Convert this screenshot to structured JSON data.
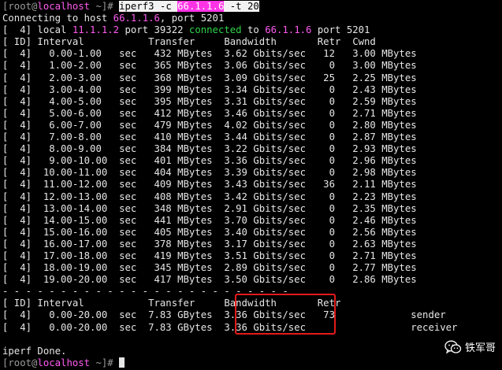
{
  "terminal": {
    "prompt": {
      "user_host": "[root@",
      "host": "localhost",
      "tail": " ~]# "
    },
    "command": {
      "prog": "iperf3 -c ",
      "ip": "66.1.1.6",
      "flags": " -t 20"
    },
    "connecting": {
      "text": "Connecting to host ",
      "host": "66.1.1.6",
      "port_text": ", port 5201"
    },
    "local_line": {
      "prefix": "[  4] local ",
      "local_ip": "11.1.1.2",
      "mid": " port 39322 ",
      "connected": "connected",
      "to": " to ",
      "remote_ip": "66.1.1.6",
      "suffix": " port 5201"
    },
    "header": "[ ID] Interval           Transfer     Bandwidth       Retr  Cwnd",
    "rows": [
      "[  4]   0.00-1.00   sec   432 MBytes  3.62 Gbits/sec   12   3.00 MBytes",
      "[  4]   1.00-2.00   sec   365 MBytes  3.06 Gbits/sec    0   3.00 MBytes",
      "[  4]   2.00-3.00   sec   368 MBytes  3.09 Gbits/sec   25   2.25 MBytes",
      "[  4]   3.00-4.00   sec   399 MBytes  3.34 Gbits/sec    0   2.43 MBytes",
      "[  4]   4.00-5.00   sec   395 MBytes  3.31 Gbits/sec    0   2.59 MBytes",
      "[  4]   5.00-6.00   sec   412 MBytes  3.46 Gbits/sec    0   2.71 MBytes",
      "[  4]   6.00-7.00   sec   479 MBytes  4.02 Gbits/sec    0   2.80 MBytes",
      "[  4]   7.00-8.00   sec   410 MBytes  3.44 Gbits/sec    0   2.87 MBytes",
      "[  4]   8.00-9.00   sec   384 MBytes  3.22 Gbits/sec    0   2.93 MBytes",
      "[  4]   9.00-10.00  sec   401 MBytes  3.36 Gbits/sec    0   2.96 MBytes",
      "[  4]  10.00-11.00  sec   404 MBytes  3.39 Gbits/sec    0   2.98 MBytes",
      "[  4]  11.00-12.00  sec   409 MBytes  3.43 Gbits/sec   36   2.11 MBytes",
      "[  4]  12.00-13.00  sec   408 MBytes  3.42 Gbits/sec    0   2.23 MBytes",
      "[  4]  13.00-14.00  sec   348 MBytes  2.91 Gbits/sec    0   2.35 MBytes",
      "[  4]  14.00-15.00  sec   441 MBytes  3.70 Gbits/sec    0   2.46 MBytes",
      "[  4]  15.00-16.00  sec   405 MBytes  3.40 Gbits/sec    0   2.56 MBytes",
      "[  4]  16.00-17.00  sec   378 MBytes  3.17 Gbits/sec    0   2.63 MBytes",
      "[  4]  17.00-18.00  sec   419 MBytes  3.51 Gbits/sec    0   2.71 MBytes",
      "[  4]  18.00-19.00  sec   345 MBytes  2.89 Gbits/sec    0   2.77 MBytes",
      "[  4]  19.00-20.00  sec   417 MBytes  3.50 Gbits/sec    0   2.86 MBytes"
    ],
    "separator": "- - - - - - - - - - - - - - - - - - - - - - - - -",
    "summary_header": "[ ID] Interval           Transfer     Bandwidth       Retr",
    "summary_rows": [
      "[  4]   0.00-20.00  sec  7.83 GBytes  3.36 Gbits/sec   73             sender",
      "[  4]   0.00-20.00  sec  7.83 GBytes  3.36 Gbits/sec                  receiver"
    ],
    "done": "iperf Done."
  },
  "watermark": {
    "label": "铁军哥",
    "icon": "wechat-icon"
  },
  "colors": {
    "background": "#000000",
    "text": "#e6e6e6",
    "prompt": "#9a9a9a",
    "ip": "#ff5cf0",
    "connected": "#2fd34a",
    "highlight_box": "#e21a1a"
  }
}
